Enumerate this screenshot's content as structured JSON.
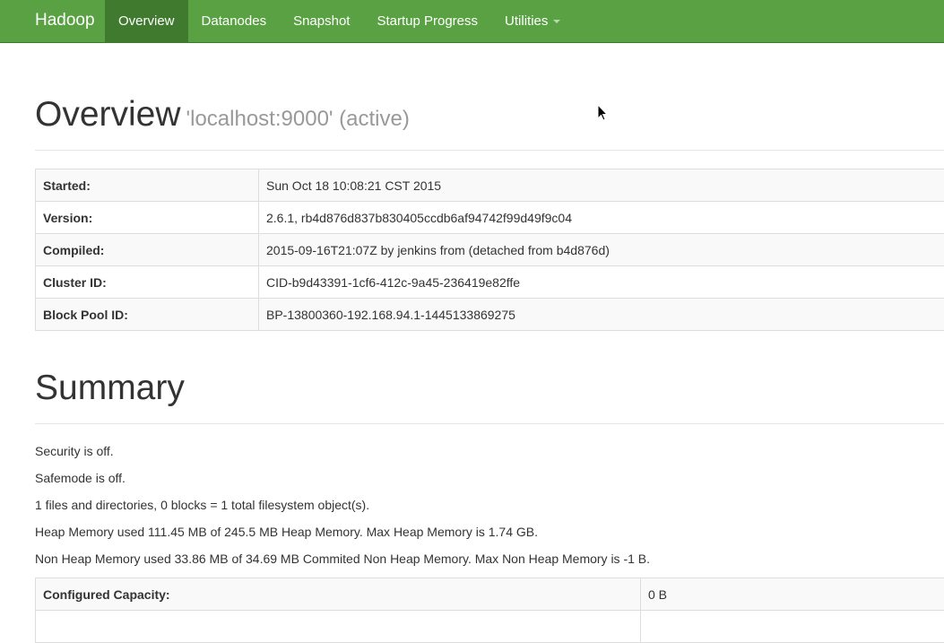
{
  "navbar": {
    "brand": "Hadoop",
    "items": [
      {
        "label": "Overview",
        "active": true
      },
      {
        "label": "Datanodes",
        "active": false
      },
      {
        "label": "Snapshot",
        "active": false
      },
      {
        "label": "Startup Progress",
        "active": false
      },
      {
        "label": "Utilities",
        "active": false,
        "dropdown": true
      }
    ],
    "accent_color": "#5aa143",
    "active_color": "#3f7a2e"
  },
  "overview": {
    "title": "Overview",
    "subtitle": "'localhost:9000' (active)",
    "rows": [
      {
        "label": "Started:",
        "value": "Sun Oct 18 10:08:21 CST 2015"
      },
      {
        "label": "Version:",
        "value": "2.6.1, rb4d876d837b830405ccdb6af94742f99d49f9c04"
      },
      {
        "label": "Compiled:",
        "value": "2015-09-16T21:07Z by jenkins from (detached from b4d876d)"
      },
      {
        "label": "Cluster ID:",
        "value": "CID-b9d43391-1cf6-412c-9a45-236419e82ffe"
      },
      {
        "label": "Block Pool ID:",
        "value": "BP-13800360-192.168.94.1-1445133869275"
      }
    ]
  },
  "summary": {
    "title": "Summary",
    "lines": [
      "Security is off.",
      "Safemode is off.",
      "1 files and directories, 0 blocks = 1 total filesystem object(s).",
      "Heap Memory used 111.45 MB of 245.5 MB Heap Memory. Max Heap Memory is 1.74 GB.",
      "Non Heap Memory used 33.86 MB of 34.69 MB Commited Non Heap Memory. Max Non Heap Memory is -1 B."
    ],
    "table": [
      {
        "label": "Configured Capacity:",
        "value": "0 B"
      }
    ]
  }
}
